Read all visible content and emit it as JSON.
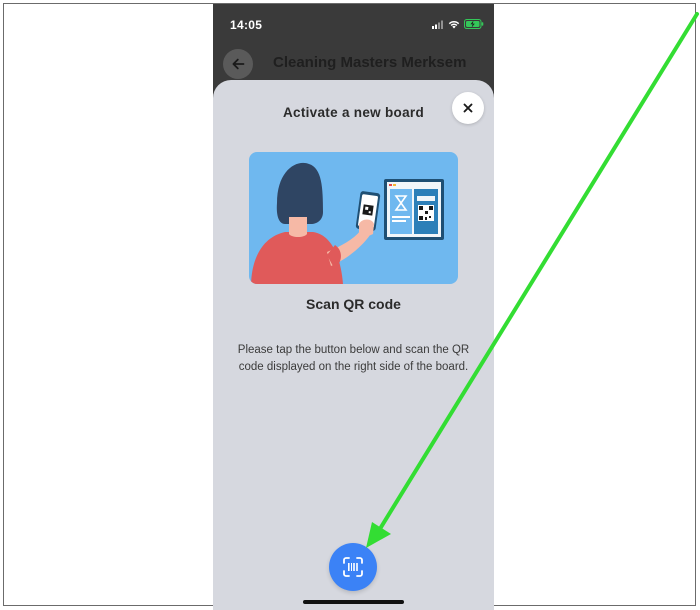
{
  "status_bar": {
    "time": "14:05",
    "battery_color": "#34c759"
  },
  "nav": {
    "title": "Cleaning Masters Merksem",
    "back_icon": "arrow-left-icon"
  },
  "sheet": {
    "title": "Activate a new board",
    "close_icon": "close-icon",
    "heading": "Scan QR code",
    "instructions": "Please tap the button below and scan the QR code displayed on the right side of the board.",
    "scan_button_icon": "barcode-scan-icon"
  },
  "colors": {
    "sheet_bg": "#d6d8df",
    "scan_button": "#3b82f6",
    "annotation_arrow": "#33dd33",
    "illustration_bg": "#6fb8ef"
  }
}
